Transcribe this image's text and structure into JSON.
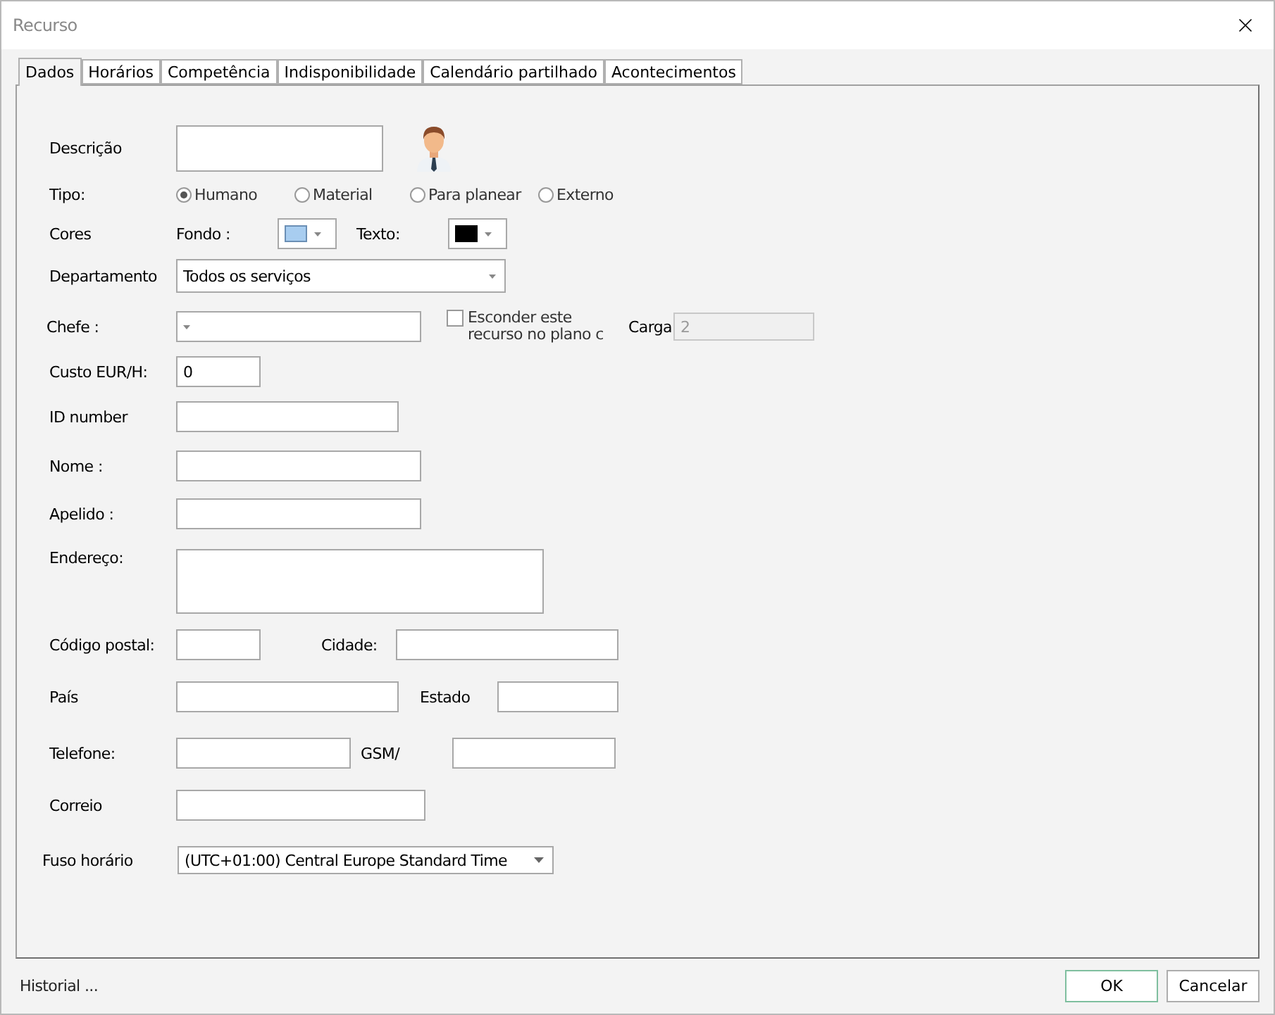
{
  "window": {
    "title": "Recurso"
  },
  "tabs": [
    {
      "label": "Dados",
      "selected": true
    },
    {
      "label": "Horários",
      "selected": false
    },
    {
      "label": "Competência",
      "selected": false
    },
    {
      "label": "Indisponibilidade",
      "selected": false
    },
    {
      "label": "Calendário partilhado",
      "selected": false
    },
    {
      "label": "Acontecimentos",
      "selected": false
    }
  ],
  "form": {
    "description": {
      "label": "Descrição"
    },
    "type": {
      "label": "Tipo:",
      "options": [
        {
          "label": "Humano",
          "selected": true
        },
        {
          "label": "Material",
          "selected": false
        },
        {
          "label": "Para planear",
          "selected": false
        },
        {
          "label": "Externo",
          "selected": false
        }
      ]
    },
    "colors": {
      "label": "Cores",
      "swatches": [
        {
          "label": "Fondo :",
          "color": "#a8cdf0"
        },
        {
          "label": "Texto:",
          "color": "#000000"
        }
      ]
    },
    "department": {
      "label": "Departamento",
      "value": "Todos os serviços"
    },
    "boss": {
      "label": "Chefe :"
    },
    "hide": {
      "label": "Esconder este recurso no plano c",
      "checked": false
    },
    "load": {
      "label": "Carga",
      "value": "2",
      "disabled": true
    },
    "cost": {
      "label": "Custo EUR/H:",
      "value": "0"
    },
    "id_number": {
      "label": "ID number"
    },
    "first_name": {
      "label": "Nome :"
    },
    "last_name": {
      "label": "Apelido :"
    },
    "address": {
      "label": "Endereço:"
    },
    "postal_code": {
      "label": "Código postal:"
    },
    "city": {
      "label": "Cidade:"
    },
    "country": {
      "label": "País"
    },
    "state": {
      "label": "Estado"
    },
    "phone": {
      "label": "Telefone:"
    },
    "mobile": {
      "label": "GSM/"
    },
    "email": {
      "label": "Correio"
    },
    "timezone": {
      "label": "Fuso horário",
      "value": "(UTC+01:00) Central Europe Standard Time"
    }
  },
  "footer": {
    "history": "Historial ...",
    "buttons": [
      {
        "label": "OK",
        "kind": "primary"
      },
      {
        "label": "Cancelar",
        "kind": "secondary"
      }
    ]
  }
}
